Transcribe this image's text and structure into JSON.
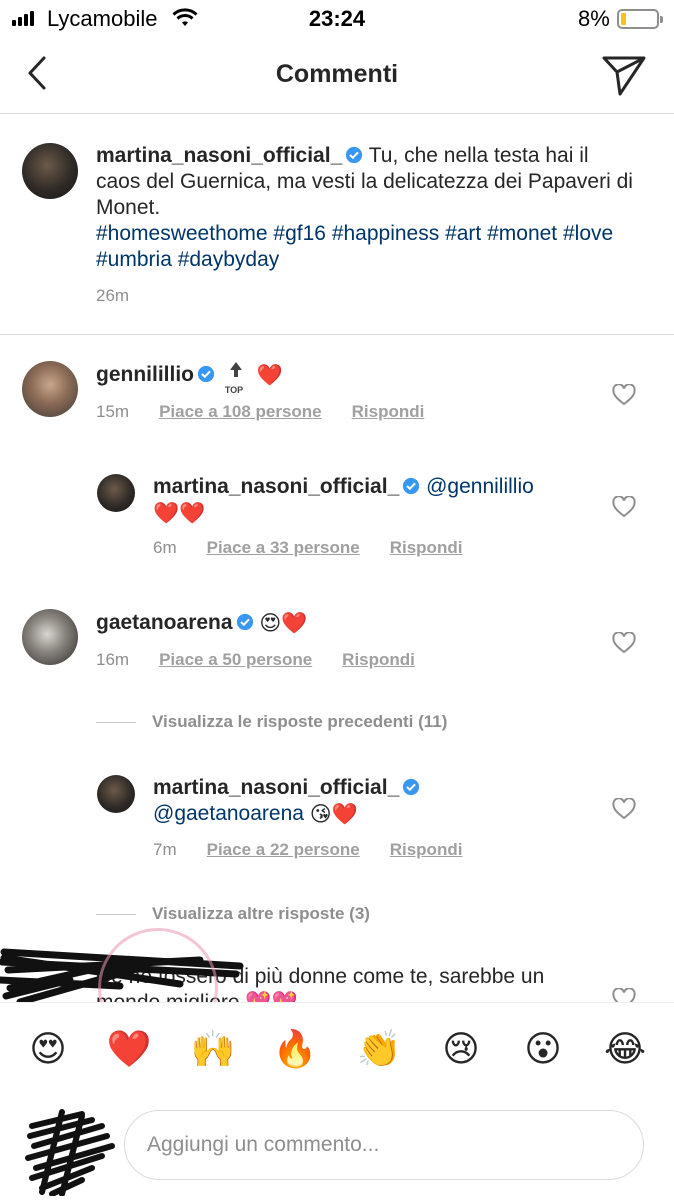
{
  "status_bar": {
    "carrier": "Lycamobile",
    "time": "23:24",
    "battery": "8%"
  },
  "nav": {
    "title": "Commenti"
  },
  "caption": {
    "username": "martina_nasoni_official_",
    "text": "Tu, che nella testa hai il caos del Guernica, ma vesti la delicatezza dei Papaveri di Monet.",
    "hashtags": "#homesweethome #gf16 #happiness #art #monet #love #umbria #daybyday",
    "time": "26m"
  },
  "comments": [
    {
      "username": "gennilillio",
      "top_label": "TOP",
      "emoji": "❤️",
      "time": "15m",
      "likes": "Piace a 108 persone",
      "reply": "Rispondi"
    },
    {
      "username": "martina_nasoni_official_",
      "mention": "@gennilillio",
      "emoji": "❤️❤️",
      "time": "6m",
      "likes": "Piace a 33 persone",
      "reply": "Rispondi"
    },
    {
      "username": "gaetanoarena",
      "emoji": "😍❤️",
      "time": "16m",
      "likes": "Piace a 50 persone",
      "reply": "Rispondi"
    },
    {
      "username": "martina_nasoni_official_",
      "mention": "@gaetanoarena",
      "emoji": "😘❤️",
      "time": "7m",
      "likes": "Piace a 22 persone",
      "reply": "Rispondi"
    }
  ],
  "view_previous": "Visualizza le risposte precedenti (11)",
  "view_more": "Visualizza altre risposte (3)",
  "partial_comment": "Ce ne fossero di più donne come te, sarebbe un mondo migliore 💖💖",
  "emoji_bar": [
    "😍",
    "❤️",
    "🙌",
    "🔥",
    "👏",
    "😢",
    "😮",
    "😂"
  ],
  "input": {
    "placeholder": "Aggiungi un commento..."
  },
  "icons": {
    "back": "chevron-left-icon",
    "send": "paper-plane-icon",
    "verified": "verified-badge-icon",
    "like": "heart-outline-icon"
  },
  "colors": {
    "hashtag": "#003569",
    "meta": "#8e8e8e",
    "verified": "#3897f0",
    "battery_fill": "#f7c21c"
  }
}
